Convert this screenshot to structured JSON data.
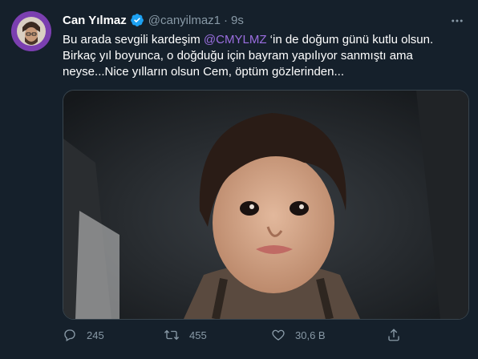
{
  "tweet": {
    "author_name": "Can Yılmaz",
    "handle": "@canyilmaz1",
    "separator": "·",
    "time": "9s",
    "text_before": "Bu arada sevgili kardeşim ",
    "mention": "@CMYLMZ",
    "text_after": " ‘in de doğum günü kutlu olsun. Birkaç yıl boyunca, o doğduğu için bayram yapılıyor sanmıştı ama neyse...Nice yılların olsun Cem, öptüm gözlerinden...",
    "stats": {
      "replies": "245",
      "retweets": "455",
      "likes": "30,6 B"
    }
  },
  "icons": {
    "verified": "verified-badge-icon",
    "more": "more-options-icon",
    "reply": "reply-icon",
    "retweet": "retweet-icon",
    "like": "heart-icon",
    "share": "share-icon"
  },
  "colors": {
    "background": "#15202b",
    "secondary_text": "#8899a6",
    "mention": "#9b6ee0",
    "verified": "#1da1f2",
    "avatar_ring": "#7b3fb0"
  }
}
